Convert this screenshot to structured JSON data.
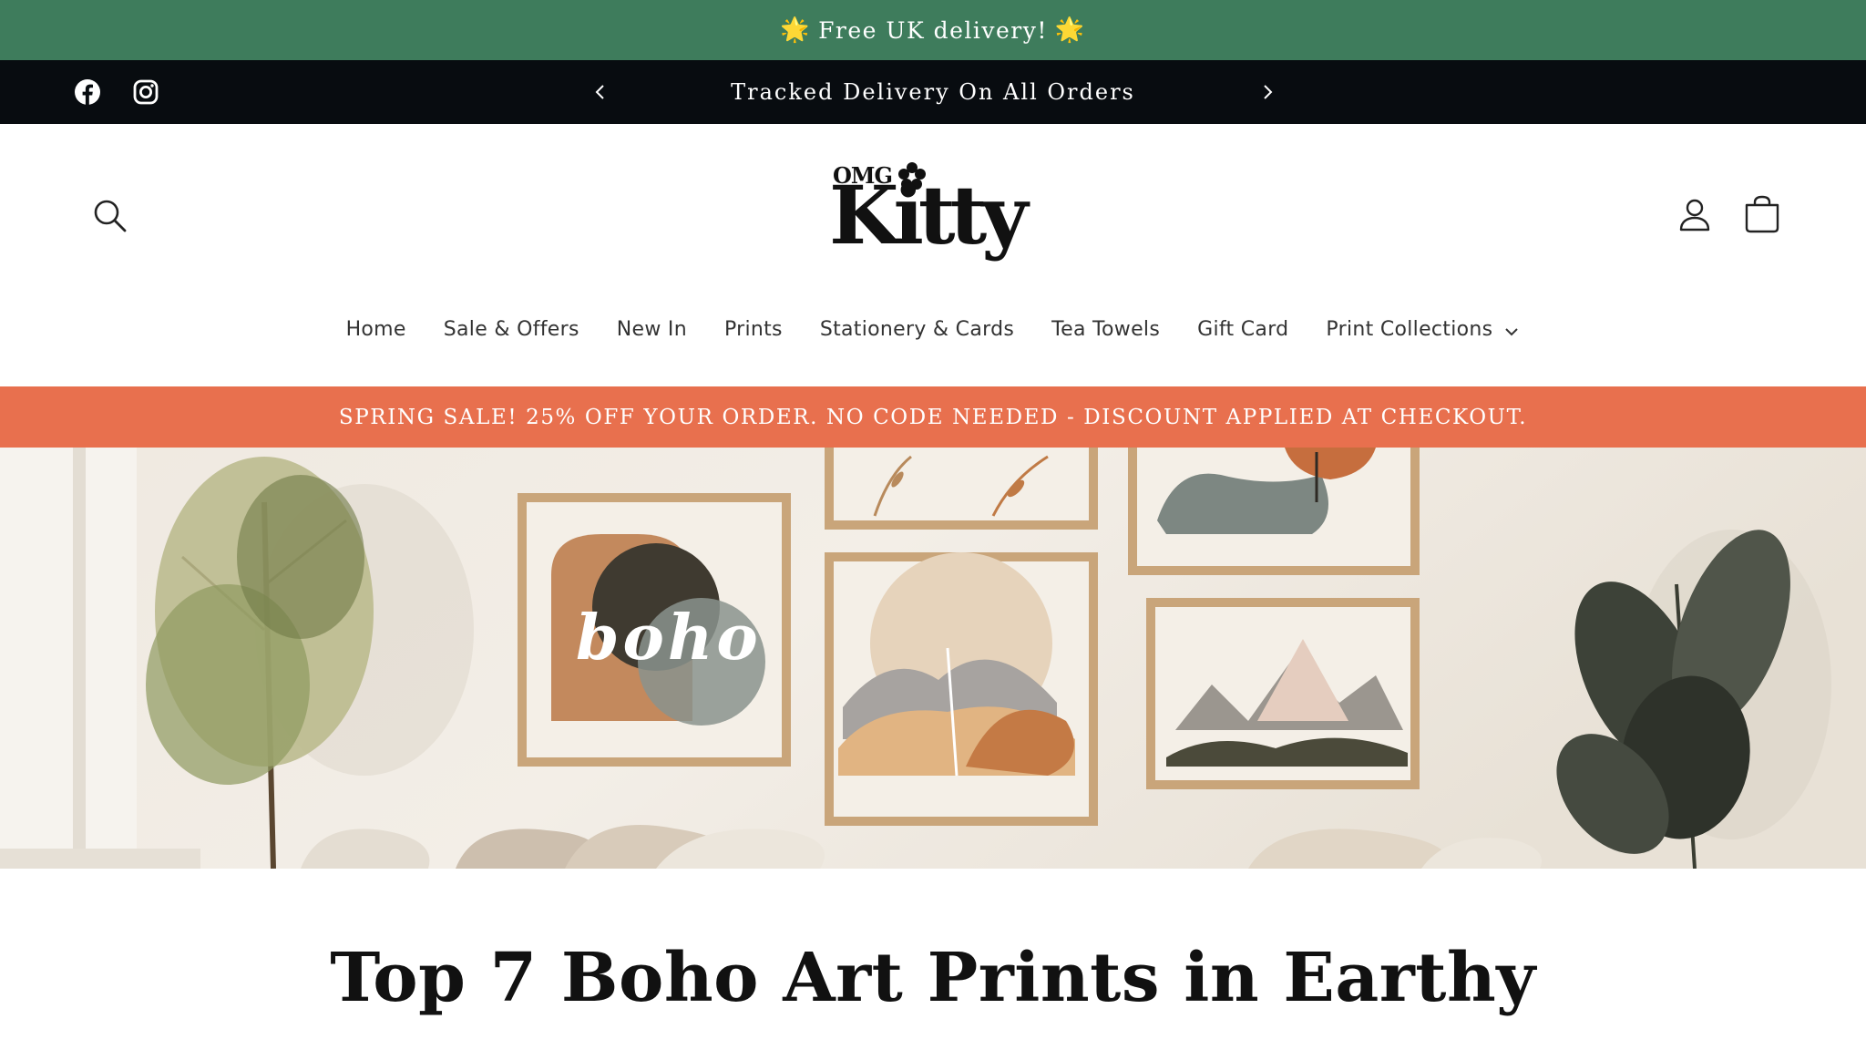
{
  "top_banner": {
    "text": "Free UK delivery!",
    "star_left": "🌟",
    "star_right": "🌟"
  },
  "announcement": {
    "message": "Tracked Delivery On All Orders"
  },
  "social": {
    "facebook": "facebook-icon",
    "instagram": "instagram-icon"
  },
  "header": {
    "logo": {
      "small": "OMG",
      "main": "Kitty"
    },
    "icons": {
      "search": "search-icon",
      "account": "user-icon",
      "cart": "cart-icon"
    }
  },
  "nav": {
    "items": [
      {
        "label": "Home"
      },
      {
        "label": "Sale & Offers"
      },
      {
        "label": "New In"
      },
      {
        "label": "Prints"
      },
      {
        "label": "Stationery & Cards"
      },
      {
        "label": "Tea Towels"
      },
      {
        "label": "Gift Card"
      },
      {
        "label": "Print Collections"
      }
    ]
  },
  "sale_bar": {
    "text": "SPRING SALE! 25% OFF YOUR ORDER. NO CODE NEEDED - DISCOUNT APPLIED AT CHECKOUT."
  },
  "hero": {
    "art_word": "boho"
  },
  "article": {
    "title": "Top 7 Boho Art Prints in Earthy"
  },
  "colors": {
    "top_banner": "#3e7c5c",
    "announcement_bar": "#080c10",
    "sale_bar": "#e8704e",
    "text": "#111111"
  }
}
